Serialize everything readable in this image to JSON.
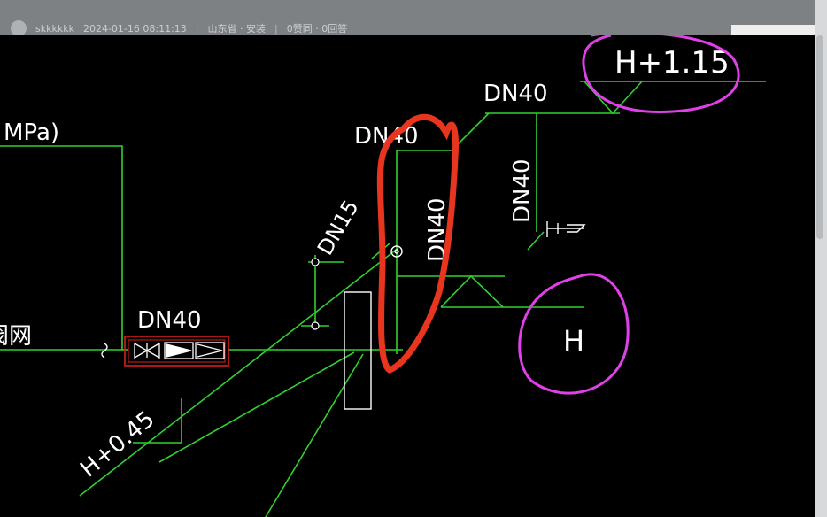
{
  "post": {
    "username": "skkkkkk",
    "timestamp": "2024-01-16 08:11:13",
    "location": "山东省 · 安装",
    "stats": "0赞同 · 0回答"
  },
  "drawing": {
    "labels": {
      "pressure_unit": "MPa)",
      "pipe_main_left": "DN40",
      "pipe_top": "DN40",
      "pipe_riser_top": "DN40",
      "pipe_vertical_right": "DN40",
      "pipe_vertical_mid": "DN40",
      "pipe_branch": "DN15",
      "fixture_label": "阀网",
      "elevation_top": "H+1.15",
      "elevation_mid": "H",
      "elevation_bottom": "H+0.45"
    },
    "colors": {
      "pipe_line": "#2fd12f",
      "text": "#ffffff",
      "valve_box": "#d81e1e",
      "annotation_red": "#e8351f",
      "annotation_magenta": "#e040e8",
      "background": "#000000"
    },
    "icons": [
      "gate-valve-icon",
      "check-valve-icon",
      "filter-icon",
      "faucet-icon",
      "elevation-triangle-icon"
    ]
  }
}
